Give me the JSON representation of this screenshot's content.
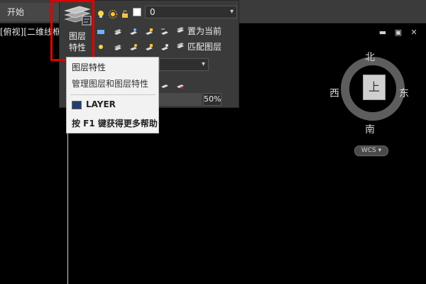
{
  "tabs": {
    "start": "开始"
  },
  "viewport": {
    "label": "[俯视][二维线框]"
  },
  "window_controls": {
    "minimize": "▬",
    "restore": "▣",
    "close": "✕"
  },
  "layer_panel": {
    "current_layer": "0",
    "layer_properties_button": "图层\n特性",
    "set_current_label": "置为当前",
    "match_layer_label": "匹配图层",
    "transparency_value": "50%"
  },
  "tooltip": {
    "title": "图层特性",
    "description": "管理图层和图层特性",
    "command": "LAYER",
    "help": "按 F1 键获得更多帮助"
  },
  "viewcube": {
    "north": "北",
    "south": "南",
    "east": "东",
    "west": "西",
    "face": "上",
    "coord": "WCS"
  },
  "colors": {
    "highlight": "#e00000",
    "ribbon": "#3a3a3a",
    "tooltip_bg": "#f2f2f2"
  },
  "icons": [
    "layer-properties-icon",
    "light-bulb-icon",
    "sun-icon",
    "padlock-icon",
    "color-square-icon",
    "layer-tool-icon",
    "command-icon",
    "chevron-down-icon"
  ]
}
